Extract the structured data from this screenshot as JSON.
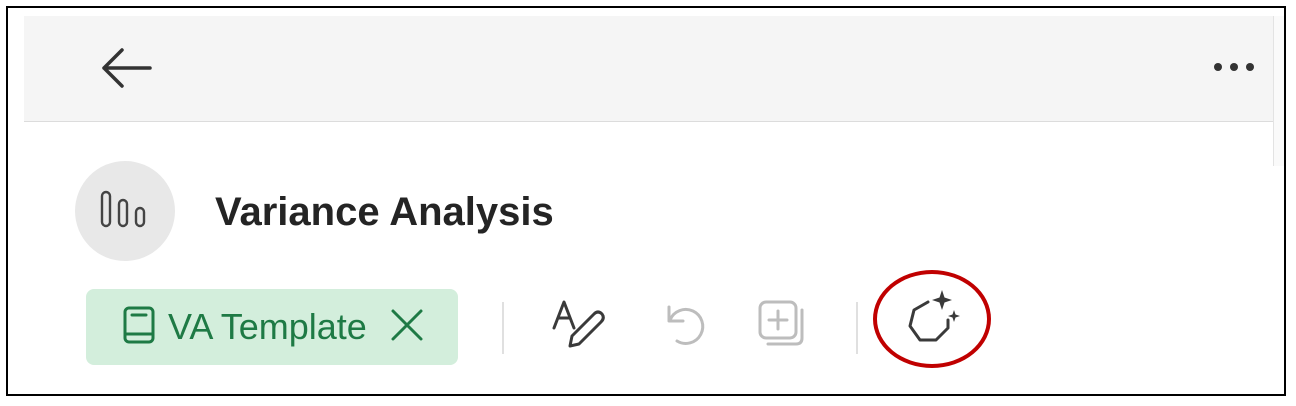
{
  "header": {
    "back_icon": "arrow-left-icon",
    "more_icon": "more-horizontal-icon"
  },
  "main": {
    "avatar_icon": "bar-chart-icon",
    "title": "Variance Analysis",
    "template_chip": {
      "label": "VA Template",
      "icon": "book-icon",
      "close_icon": "close-icon"
    },
    "toolbar": [
      {
        "icon": "rewrite-pen-icon",
        "enabled": true
      },
      {
        "icon": "undo-icon",
        "enabled": false
      },
      {
        "icon": "add-copy-icon",
        "enabled": false
      },
      {
        "icon": "sparkle-hexagon-icon",
        "enabled": true,
        "highlighted": true
      }
    ]
  },
  "colors": {
    "chip_bg": "#d3eedc",
    "chip_text": "#1e7a45",
    "highlight": "#c00000",
    "disabled_icon": "#bdbdbd",
    "icon": "#3a3a3a"
  }
}
